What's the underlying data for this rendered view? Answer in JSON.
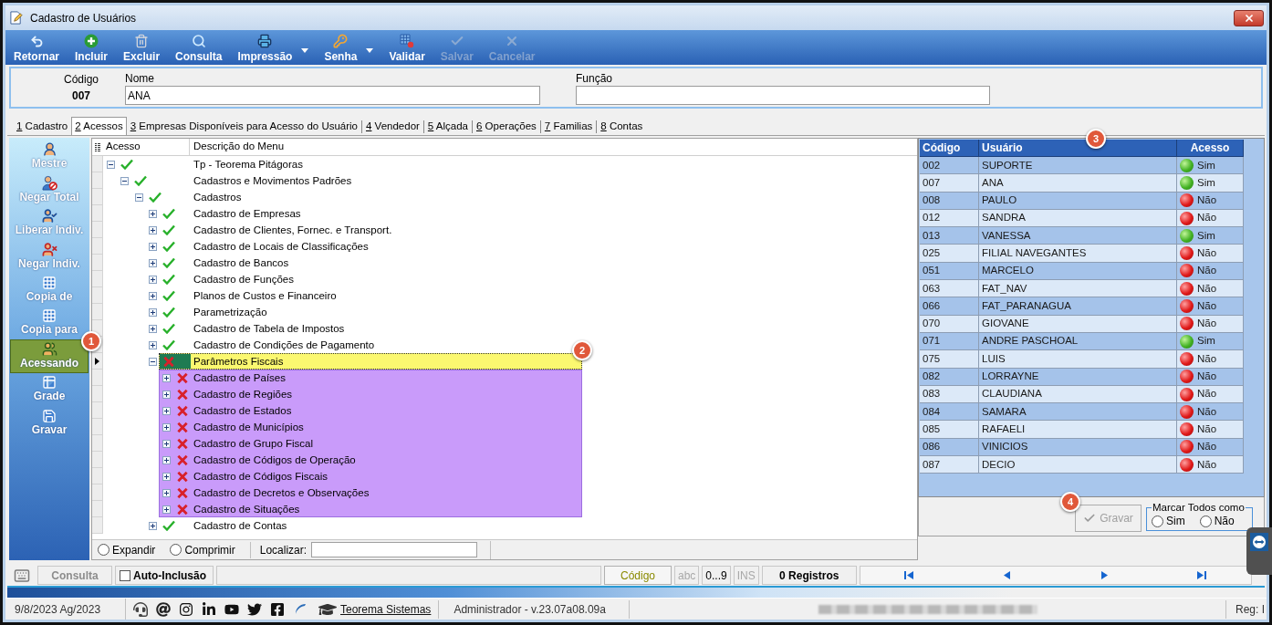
{
  "window": {
    "title": "Cadastro de Usuários"
  },
  "toolbar": [
    {
      "label": "Retornar",
      "disabled": false,
      "menu": false
    },
    {
      "label": "Incluir",
      "disabled": false,
      "menu": false
    },
    {
      "label": "Excluir",
      "disabled": false,
      "menu": false
    },
    {
      "label": "Consulta",
      "disabled": false,
      "menu": false
    },
    {
      "label": "Impressão",
      "disabled": false,
      "menu": true
    },
    {
      "label": "Senha",
      "disabled": false,
      "menu": true
    },
    {
      "label": "Validar",
      "disabled": false,
      "menu": false
    },
    {
      "label": "Salvar",
      "disabled": true,
      "menu": false
    },
    {
      "label": "Cancelar",
      "disabled": true,
      "menu": false
    }
  ],
  "record": {
    "code_label": "Código",
    "code": "007",
    "name_label": "Nome",
    "name": "ANA",
    "role_label": "Função"
  },
  "tabs": [
    {
      "label": "1 Cadastro",
      "selected": false
    },
    {
      "label": "2 Acessos",
      "selected": true
    },
    {
      "label": "3 Empresas Disponíveis para Acesso do Usuário",
      "selected": false
    },
    {
      "label": "4 Vendedor",
      "selected": false
    },
    {
      "label": "5 Alçada",
      "selected": false
    },
    {
      "label": "6 Operações",
      "selected": false
    },
    {
      "label": "7 Familias",
      "selected": false
    },
    {
      "label": "8 Contas",
      "selected": false
    }
  ],
  "sidebar": [
    {
      "label": "Mestre",
      "selected": false
    },
    {
      "label": "Negar Total",
      "selected": false
    },
    {
      "label": "Liberar Indiv.",
      "selected": false
    },
    {
      "label": "Negar Indiv.",
      "selected": false
    },
    {
      "label": "Copia de",
      "selected": false
    },
    {
      "label": "Copia para",
      "selected": false
    },
    {
      "label": "Acessando",
      "selected": true,
      "marker": "1"
    },
    {
      "label": "Grade",
      "selected": false
    },
    {
      "label": "Gravar",
      "selected": false
    }
  ],
  "tree": {
    "columns": [
      "Acesso",
      "Descrição do Menu"
    ],
    "nodes": [
      {
        "label": "Tp - Teorema Pitágoras",
        "access": true,
        "expanded": true,
        "selected": false,
        "children": [
          {
            "label": "Cadastros e Movimentos Padrões",
            "access": true,
            "expanded": true,
            "selected": false,
            "children": [
              {
                "label": "Cadastros",
                "access": true,
                "expanded": true,
                "selected": false,
                "children": [
                  {
                    "label": "Cadastro de Empresas",
                    "access": true,
                    "expanded": false,
                    "selected": false
                  },
                  {
                    "label": "Cadastro de Clientes, Fornec. e Transport.",
                    "access": true,
                    "expanded": false,
                    "selected": false
                  },
                  {
                    "label": "Cadastro de Locais de Classificações",
                    "access": true,
                    "expanded": false,
                    "selected": false
                  },
                  {
                    "label": "Cadastro de Bancos",
                    "access": true,
                    "expanded": false,
                    "selected": false
                  },
                  {
                    "label": "Cadastro de Funções",
                    "access": true,
                    "expanded": false,
                    "selected": false
                  },
                  {
                    "label": "Planos de Custos e Financeiro",
                    "access": true,
                    "expanded": false,
                    "selected": false
                  },
                  {
                    "label": "Parametrização",
                    "access": true,
                    "expanded": false,
                    "selected": false
                  },
                  {
                    "label": "Cadastro de Tabela de Impostos",
                    "access": true,
                    "expanded": false,
                    "selected": false
                  },
                  {
                    "label": "Cadastro de Condições de Pagamento",
                    "access": true,
                    "expanded": false,
                    "selected": false
                  },
                  {
                    "label": "Parâmetros Fiscais",
                    "access": false,
                    "expanded": true,
                    "selected": true,
                    "marker": "2",
                    "children": [
                      {
                        "label": "Cadastro de Países",
                        "access": false,
                        "expanded": false,
                        "selected": false
                      },
                      {
                        "label": "Cadastro de Regiões",
                        "access": false,
                        "expanded": false,
                        "selected": false
                      },
                      {
                        "label": "Cadastro de Estados",
                        "access": false,
                        "expanded": false,
                        "selected": false
                      },
                      {
                        "label": "Cadastro de Municípios",
                        "access": false,
                        "expanded": false,
                        "selected": false
                      },
                      {
                        "label": "Cadastro de Grupo Fiscal",
                        "access": false,
                        "expanded": false,
                        "selected": false
                      },
                      {
                        "label": "Cadastro de Códigos de Operação",
                        "access": false,
                        "expanded": false,
                        "selected": false
                      },
                      {
                        "label": "Cadastro de Códigos Fiscais",
                        "access": false,
                        "expanded": false,
                        "selected": false
                      },
                      {
                        "label": "Cadastro de Decretos e Observações",
                        "access": false,
                        "expanded": false,
                        "selected": false
                      },
                      {
                        "label": "Cadastro de Situações",
                        "access": false,
                        "expanded": false,
                        "selected": false
                      }
                    ]
                  },
                  {
                    "label": "Cadastro de Contas",
                    "access": true,
                    "expanded": false,
                    "selected": false
                  }
                ]
              }
            ]
          }
        ]
      }
    ]
  },
  "tree_footer": {
    "options": [
      {
        "label": "Expandir",
        "selected": false
      },
      {
        "label": "Comprimir",
        "selected": false
      }
    ],
    "search_label": "Localizar:"
  },
  "users": {
    "marker": "3",
    "columns": [
      "Código",
      "Usuário",
      "Acesso"
    ],
    "rows": [
      {
        "code": "002",
        "user": "SUPORTE",
        "access": "Sim",
        "granted": true
      },
      {
        "code": "007",
        "user": "ANA",
        "access": "Sim",
        "granted": true
      },
      {
        "code": "008",
        "user": "PAULO",
        "access": "Não",
        "granted": false
      },
      {
        "code": "012",
        "user": "SANDRA",
        "access": "Não",
        "granted": false
      },
      {
        "code": "013",
        "user": "VANESSA",
        "access": "Sim",
        "granted": true
      },
      {
        "code": "025",
        "user": "FILIAL NAVEGANTES",
        "access": "Não",
        "granted": false
      },
      {
        "code": "051",
        "user": "MARCELO",
        "access": "Não",
        "granted": false
      },
      {
        "code": "063",
        "user": "FAT_NAV",
        "access": "Não",
        "granted": false
      },
      {
        "code": "066",
        "user": "FAT_PARANAGUA",
        "access": "Não",
        "granted": false
      },
      {
        "code": "070",
        "user": "GIOVANE",
        "access": "Não",
        "granted": false
      },
      {
        "code": "071",
        "user": "ANDRE PASCHOAL",
        "access": "Sim",
        "granted": true
      },
      {
        "code": "075",
        "user": "LUIS",
        "access": "Não",
        "granted": false
      },
      {
        "code": "082",
        "user": "LORRAYNE",
        "access": "Não",
        "granted": false
      },
      {
        "code": "083",
        "user": "CLAUDIANA",
        "access": "Não",
        "granted": false
      },
      {
        "code": "084",
        "user": "SAMARA",
        "access": "Não",
        "granted": false
      },
      {
        "code": "085",
        "user": "RAFAELI",
        "access": "Não",
        "granted": false
      },
      {
        "code": "086",
        "user": "VINICIOS",
        "access": "Não",
        "granted": false
      },
      {
        "code": "087",
        "user": "DECIO",
        "access": "Não",
        "granted": false
      }
    ]
  },
  "users_footer": {
    "save": {
      "label": "Gravar",
      "disabled": true,
      "marker": "4"
    },
    "mark_all": {
      "legend": "Marcar Todos como",
      "options": [
        {
          "label": "Sim",
          "selected": false
        },
        {
          "label": "Não",
          "selected": false
        }
      ]
    }
  },
  "status_bar": {
    "mode": "Consulta",
    "auto_insert": {
      "label": "Auto-Inclusão",
      "checked": false
    },
    "sort_field": "Código",
    "indicators": [
      {
        "label": "abc",
        "on": false
      },
      {
        "label": "0...9",
        "on": true
      },
      {
        "label": "INS",
        "on": false
      }
    ],
    "count": "0 Registros"
  },
  "taskbar": {
    "date": "9/8/2023 Ag/2023",
    "company_link": "Teorema Sistemas",
    "user_version": "Administrador - v.23.07a08.09a",
    "reg": "Reg: I"
  }
}
